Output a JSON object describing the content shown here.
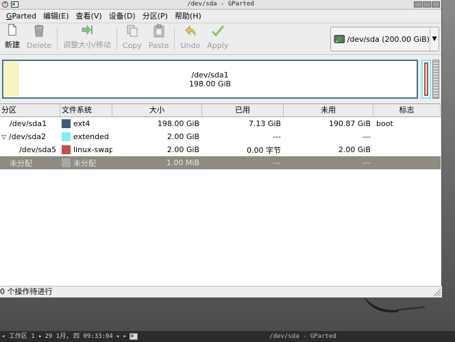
{
  "window": {
    "title": "/dev/sda - GParted"
  },
  "menu": {
    "items": [
      {
        "label": "GParted",
        "mnemonic": "G"
      },
      {
        "label": "编辑(E)"
      },
      {
        "label": "查看(V)"
      },
      {
        "label": "设备(D)"
      },
      {
        "label": "分区(P)"
      },
      {
        "label": "帮助(H)"
      }
    ]
  },
  "toolbar": {
    "new_label": "新建",
    "delete_label": "Delete",
    "resize_label": "调整大小/移动",
    "copy_label": "Copy",
    "paste_label": "Paste",
    "undo_label": "Undo",
    "apply_label": "Apply"
  },
  "device": {
    "selected": "/dev/sda  (200.00 GiB)"
  },
  "partition_map": {
    "main_name": "/dev/sda1",
    "main_size": "198.00 GiB",
    "used_fraction": 0.036
  },
  "table": {
    "headers": [
      "分区",
      "文件系统",
      "大小",
      "已用",
      "未用",
      "标志"
    ],
    "rows": [
      {
        "partition": "/dev/sda1",
        "filesystem": "ext4",
        "size": "198.00 GiB",
        "used": "7.13 GiB",
        "unused": "190.87 GiB",
        "flags": "boot",
        "color": "#3f5b7a",
        "indent": 1,
        "expander": ""
      },
      {
        "partition": "/dev/sda2",
        "filesystem": "extended",
        "size": "2.00 GiB",
        "used": "---",
        "unused": "---",
        "flags": "",
        "color": "#7ff0f4",
        "indent": 0,
        "expander": "▽"
      },
      {
        "partition": "/dev/sda5",
        "filesystem": "linux-swap",
        "size": "2.00 GiB",
        "used": "0.00 字节",
        "unused": "2.00 GiB",
        "flags": "",
        "color": "#c0504d",
        "indent": 2,
        "expander": ""
      },
      {
        "partition": "未分配",
        "filesystem": "未分配",
        "size": "1.00 MiB",
        "used": "---",
        "unused": "---",
        "flags": "",
        "color": "#a8a8a8",
        "indent": 0,
        "expander": "",
        "selected": true
      }
    ]
  },
  "status": {
    "text": "0 个操作待进行"
  },
  "taskbar": {
    "workspace": "◂ 工作区 1 ▸",
    "clock": "29 1月, 四 09:33:04",
    "nav": "◂ ▸",
    "task": "/dev/sda - GParted"
  },
  "colors": {
    "ext4": "#3f5b7a",
    "extended": "#7ff0f4",
    "swap": "#c0504d",
    "unallocated": "#a8a8a8",
    "selected_row": "#8f8b82"
  }
}
